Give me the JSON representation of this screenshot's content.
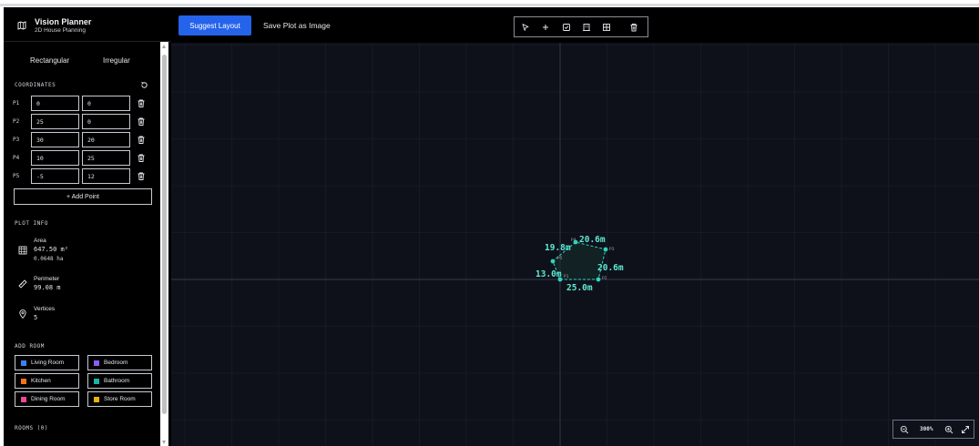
{
  "app": {
    "title": "Vision Planner",
    "subtitle": "2D House Planning"
  },
  "sidebar": {
    "shape_tabs": [
      "Rectangular",
      "Irregular"
    ],
    "coordinates_label": "COORDINATES",
    "points": [
      {
        "label": "P1",
        "x": "0",
        "y": "0"
      },
      {
        "label": "P2",
        "x": "25",
        "y": "0"
      },
      {
        "label": "P3",
        "x": "30",
        "y": "20"
      },
      {
        "label": "P4",
        "x": "10",
        "y": "25"
      },
      {
        "label": "P5",
        "x": "-5",
        "y": "12"
      }
    ],
    "add_point_label": "+ Add Point",
    "plot_info_label": "PLOT INFO",
    "area": {
      "label": "Area",
      "value": "647.50 m²",
      "secondary": "0.0648 ha"
    },
    "perimeter": {
      "label": "Perimeter",
      "value": "99.08 m"
    },
    "vertices": {
      "label": "Vertices",
      "value": "5"
    },
    "add_room_label": "ADD ROOM",
    "rooms": [
      {
        "label": "Living Room",
        "color": "#3b82f6"
      },
      {
        "label": "Bedroom",
        "color": "#8b5cf6"
      },
      {
        "label": "Kitchen",
        "color": "#f97316"
      },
      {
        "label": "Bathroom",
        "color": "#14b8a6"
      },
      {
        "label": "Dining Room",
        "color": "#ec4899"
      },
      {
        "label": "Store Room",
        "color": "#eab308"
      }
    ],
    "rooms_count_label": "ROOMS (0)"
  },
  "toolbar": {
    "suggest_label": "Suggest Layout",
    "save_label": "Save Plot as Image",
    "tools": [
      "select-icon",
      "plus-icon",
      "checkbox-icon",
      "building-icon",
      "grid-icon",
      "trash-icon"
    ]
  },
  "canvas": {
    "accent_color": "#2dd4bf",
    "edge_labels": [
      "25.0m",
      "20.6m",
      "20.6m",
      "19.8m",
      "13.0m"
    ],
    "vertex_labels": [
      "P1",
      "P2",
      "P3",
      "P4",
      "P5"
    ]
  },
  "zoom": {
    "value": "300%"
  }
}
